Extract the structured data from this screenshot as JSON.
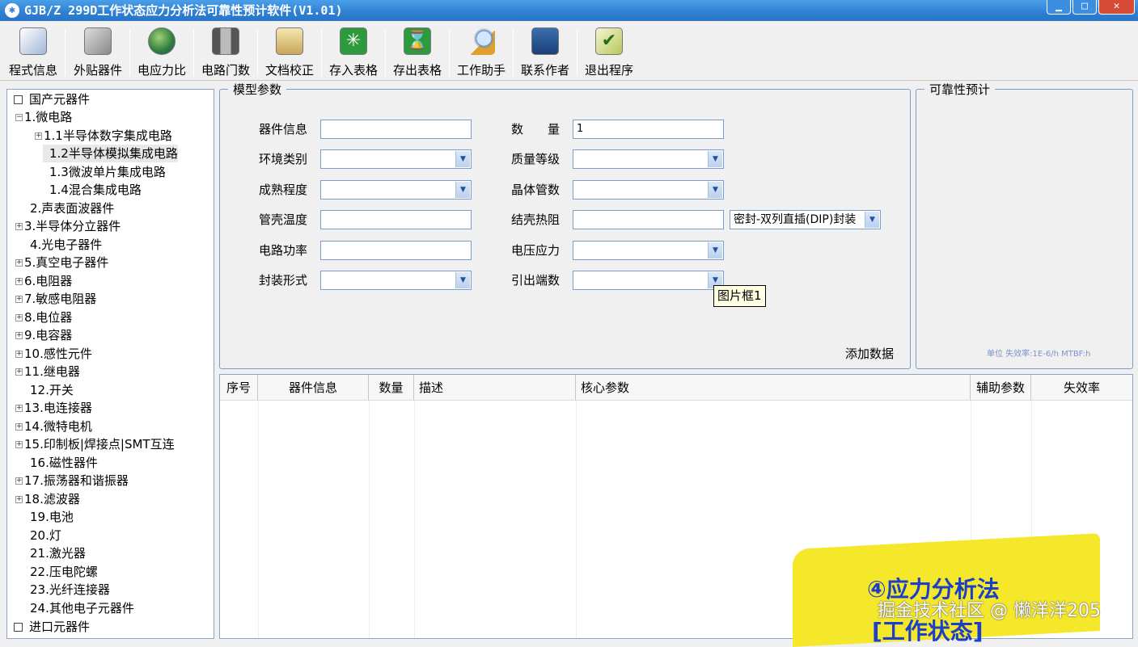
{
  "window": {
    "title": "GJB/Z 299D工作状态应力分析法可靠性预计软件(V1.01)",
    "min": "▁",
    "max": "□",
    "close": "✕"
  },
  "toolbar": [
    {
      "label": "程式信息",
      "icon": "document-info-icon"
    },
    {
      "label": "外贴器件",
      "icon": "find-icon"
    },
    {
      "label": "电应力比",
      "icon": "globe-icon"
    },
    {
      "label": "电路门数",
      "icon": "gates-icon"
    },
    {
      "label": "文档校正",
      "icon": "printer-icon"
    },
    {
      "label": "存入表格",
      "icon": "import-icon"
    },
    {
      "label": "存出表格",
      "icon": "hourglass-icon"
    },
    {
      "label": "工作助手",
      "icon": "magnifier-icon"
    },
    {
      "label": "联系作者",
      "icon": "network-icon"
    },
    {
      "label": "退出程序",
      "icon": "exit-icon"
    }
  ],
  "tree": {
    "root1": "国产元器件",
    "root2": "进口元器件",
    "items": [
      {
        "label": "1.微电路"
      },
      {
        "label": "1.1半导体数字集成电路"
      },
      {
        "label": "1.2半导体模拟集成电路"
      },
      {
        "label": "1.3微波单片集成电路"
      },
      {
        "label": "1.4混合集成电路"
      },
      {
        "label": "2.声表面波器件"
      },
      {
        "label": "3.半导体分立器件"
      },
      {
        "label": "4.光电子器件"
      },
      {
        "label": "5.真空电子器件"
      },
      {
        "label": "6.电阻器"
      },
      {
        "label": "7.敏感电阻器"
      },
      {
        "label": "8.电位器"
      },
      {
        "label": "9.电容器"
      },
      {
        "label": "10.感性元件"
      },
      {
        "label": "11.继电器"
      },
      {
        "label": "12.开关"
      },
      {
        "label": "13.电连接器"
      },
      {
        "label": "14.微特电机"
      },
      {
        "label": "15.印制板|焊接点|SMT互连"
      },
      {
        "label": "16.磁性器件"
      },
      {
        "label": "17.振荡器和谐振器"
      },
      {
        "label": "18.滤波器"
      },
      {
        "label": "19.电池"
      },
      {
        "label": "20.灯"
      },
      {
        "label": "21.激光器"
      },
      {
        "label": "22.压电陀螺"
      },
      {
        "label": "23.光纤连接器"
      },
      {
        "label": "24.其他电子元器件"
      }
    ]
  },
  "model": {
    "title": "模型参数",
    "fields": {
      "device_info": {
        "label": "器件信息",
        "value": ""
      },
      "env": {
        "label": "环境类别",
        "value": ""
      },
      "maturity": {
        "label": "成熟程度",
        "value": ""
      },
      "case_temp": {
        "label": "管壳温度",
        "value": ""
      },
      "power": {
        "label": "电路功率",
        "value": ""
      },
      "package": {
        "label": "封装形式",
        "value": ""
      },
      "qty": {
        "label": "数　　量",
        "value": "1"
      },
      "quality": {
        "label": "质量等级",
        "value": ""
      },
      "transistors": {
        "label": "晶体管数",
        "value": ""
      },
      "thermal": {
        "label": "结壳热阻",
        "value": ""
      },
      "thermal_pkg": {
        "value": "密封-双列直插(DIP)封装"
      },
      "voltage": {
        "label": "电压应力",
        "value": ""
      },
      "pins": {
        "label": "引出端数",
        "value": ""
      }
    },
    "tooltip": "图片框1",
    "add_button": "添加数据"
  },
  "prediction": {
    "title": "可靠性预计",
    "unit": "单位 失效率:1E-6/h  MTBF:h"
  },
  "grid": {
    "columns": [
      "序号",
      "器件信息",
      "数量",
      "描述",
      "核心参数",
      "辅助参数",
      "失效率"
    ]
  },
  "overlay": {
    "line1": "④应力分析法",
    "line2": "[工作状态]",
    "credit": "掘金技术社区 @ 懒洋洋205"
  }
}
